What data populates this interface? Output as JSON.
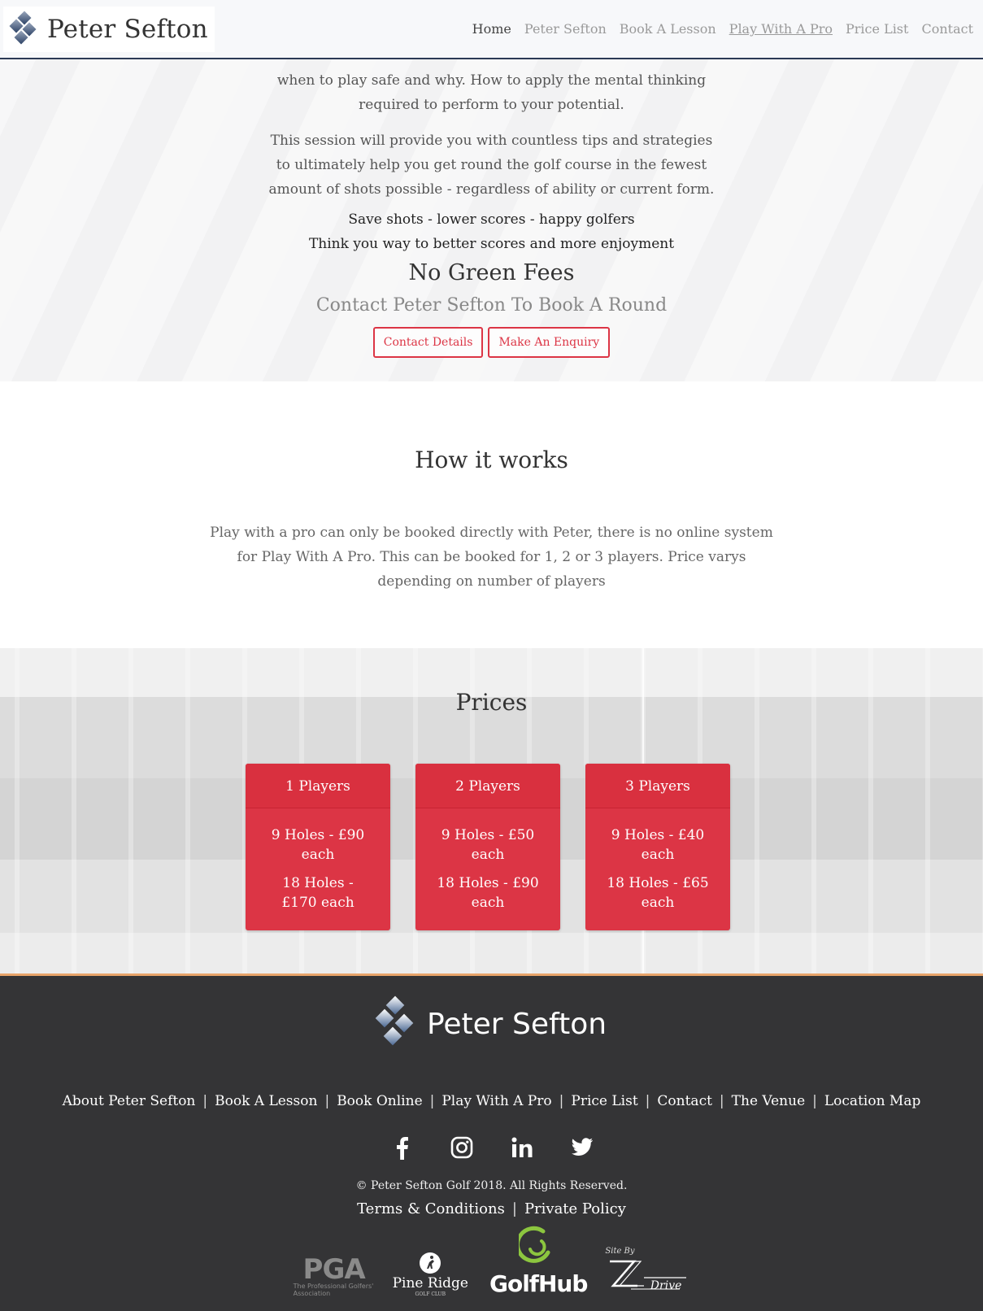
{
  "header": {
    "logo_text": "Peter Sefton",
    "nav": [
      {
        "label": "Home"
      },
      {
        "label": "Peter Sefton"
      },
      {
        "label": "Book A Lesson"
      },
      {
        "label": "Play With A Pro"
      },
      {
        "label": "Price List"
      },
      {
        "label": "Contact"
      }
    ]
  },
  "hero": {
    "paragraph1": "when to play safe and why. How to apply the mental thinking required to perform to your potential.",
    "paragraph2": "This session will provide you with countless tips and strategies to ultimately help you get round the golf course in the fewest amount of shots possible - regardless of ability or current form.",
    "tagline1": "Save shots - lower scores - happy golfers",
    "tagline2": "Think you way to better scores and more enjoyment",
    "heading": "No Green Fees",
    "subheading": "Contact Peter Sefton To Book A Round",
    "contact_button": "Contact Details",
    "enquiry_button": "Make An Enquiry"
  },
  "how_it_works": {
    "title": "How it works",
    "body": "Play with a pro can only be booked directly with Peter, there is no online system for Play With A Pro. This can be booked for 1, 2 or 3 players. Price varys depending on number of players"
  },
  "prices": {
    "title": "Prices",
    "cards": [
      {
        "players": "1 Players",
        "nine": "9 Holes - £90 each",
        "eighteen": "18 Holes - £170 each"
      },
      {
        "players": "2 Players",
        "nine": "9 Holes - £50 each",
        "eighteen": "18 Holes - £90 each"
      },
      {
        "players": "3 Players",
        "nine": "9 Holes - £40 each",
        "eighteen": "18 Holes - £65 each"
      }
    ]
  },
  "footer": {
    "logo_text": "Peter Sefton",
    "links": [
      {
        "label": "About Peter Sefton"
      },
      {
        "label": "Book A Lesson"
      },
      {
        "label": "Book Online"
      },
      {
        "label": "Play With A Pro"
      },
      {
        "label": "Price List"
      },
      {
        "label": "Contact"
      },
      {
        "label": "The Venue"
      },
      {
        "label": "Location Map"
      }
    ],
    "separator": "|",
    "social_icons": [
      "facebook-icon",
      "instagram-icon",
      "linkedin-icon",
      "twitter-icon"
    ],
    "copyright": "© Peter Sefton Golf 2018. All Rights Reserved.",
    "terms": "Terms & Conditions",
    "privacy": "Private Policy",
    "partners": {
      "pga": "PGA",
      "pga_sub": "The Professional Golfers' Association",
      "pine_ridge": "Pine Ridge",
      "pine_ridge_sub": "GOLF CLUB",
      "golfhub": "GolfHub",
      "site_by": "Site By",
      "zdrive": "Drive"
    }
  },
  "colors": {
    "accent_red": "#dc3545",
    "nav_border": "#2b3a55",
    "footer_bg": "#343436",
    "footer_top_border": "#e8a46a"
  }
}
